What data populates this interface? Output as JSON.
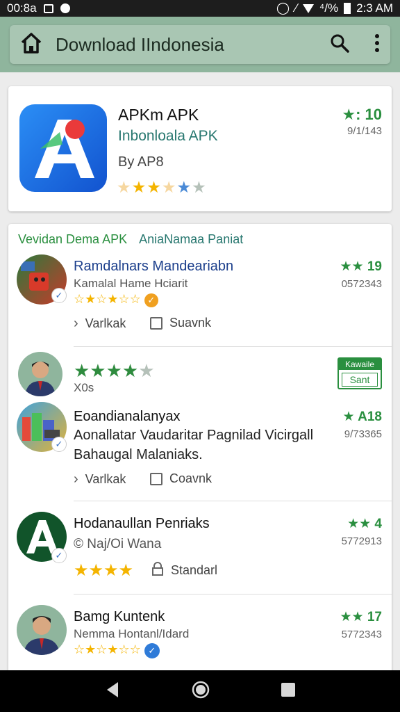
{
  "status_bar": {
    "time_left": "00:8a",
    "time_right": "2:3 AM",
    "signal_text": "⁴/%"
  },
  "app_bar": {
    "title": "Download IIndonesia",
    "icons": [
      "home-icon",
      "search-icon",
      "more-vert-icon"
    ]
  },
  "featured": {
    "title": "APKm APK",
    "subtitle": "Inbonloala APK",
    "developer": "By AP8",
    "rating": "★: 10",
    "count": "9/1/143",
    "stars": 4.5
  },
  "list": {
    "header_left": "Vevidan Dema APK",
    "header_right": "AniaNamaa Paniat",
    "items": [
      {
        "title": "Ramdalnars Mandeariabn",
        "subtitle": "Kamalal Hame Hciarit",
        "rating": "★★ 19",
        "count": "0572343",
        "action1": "Varlkak",
        "action2": "Suavnk"
      },
      {
        "subtitle": "X0s",
        "install_top": "Kawaile",
        "install_label": "Sant"
      },
      {
        "title": "Eoandianalanyax",
        "description": "Aonallatar Vaudaritar Pagnilad Vicirgall Bahaugal Malaniaks.",
        "rating": "★ A18",
        "count": "9/73365",
        "action1": "Varlkak",
        "action2": "Coavnk"
      },
      {
        "title": "Hodanaullan Penriaks",
        "subtitle": "© Naj/Oi Wana",
        "rating": "★★ 4",
        "count": "5772913",
        "action_label": "Standarl"
      },
      {
        "title": "Bamg Kuntenk",
        "subtitle": "Nemma Hontanl/Idard",
        "rating": "★★ 17",
        "count": "5772343"
      }
    ]
  },
  "colors": {
    "accent_green": "#2a8f3f",
    "app_bar": "#8fb59d",
    "teal_text": "#27776f",
    "star_gold": "#f4b400"
  }
}
